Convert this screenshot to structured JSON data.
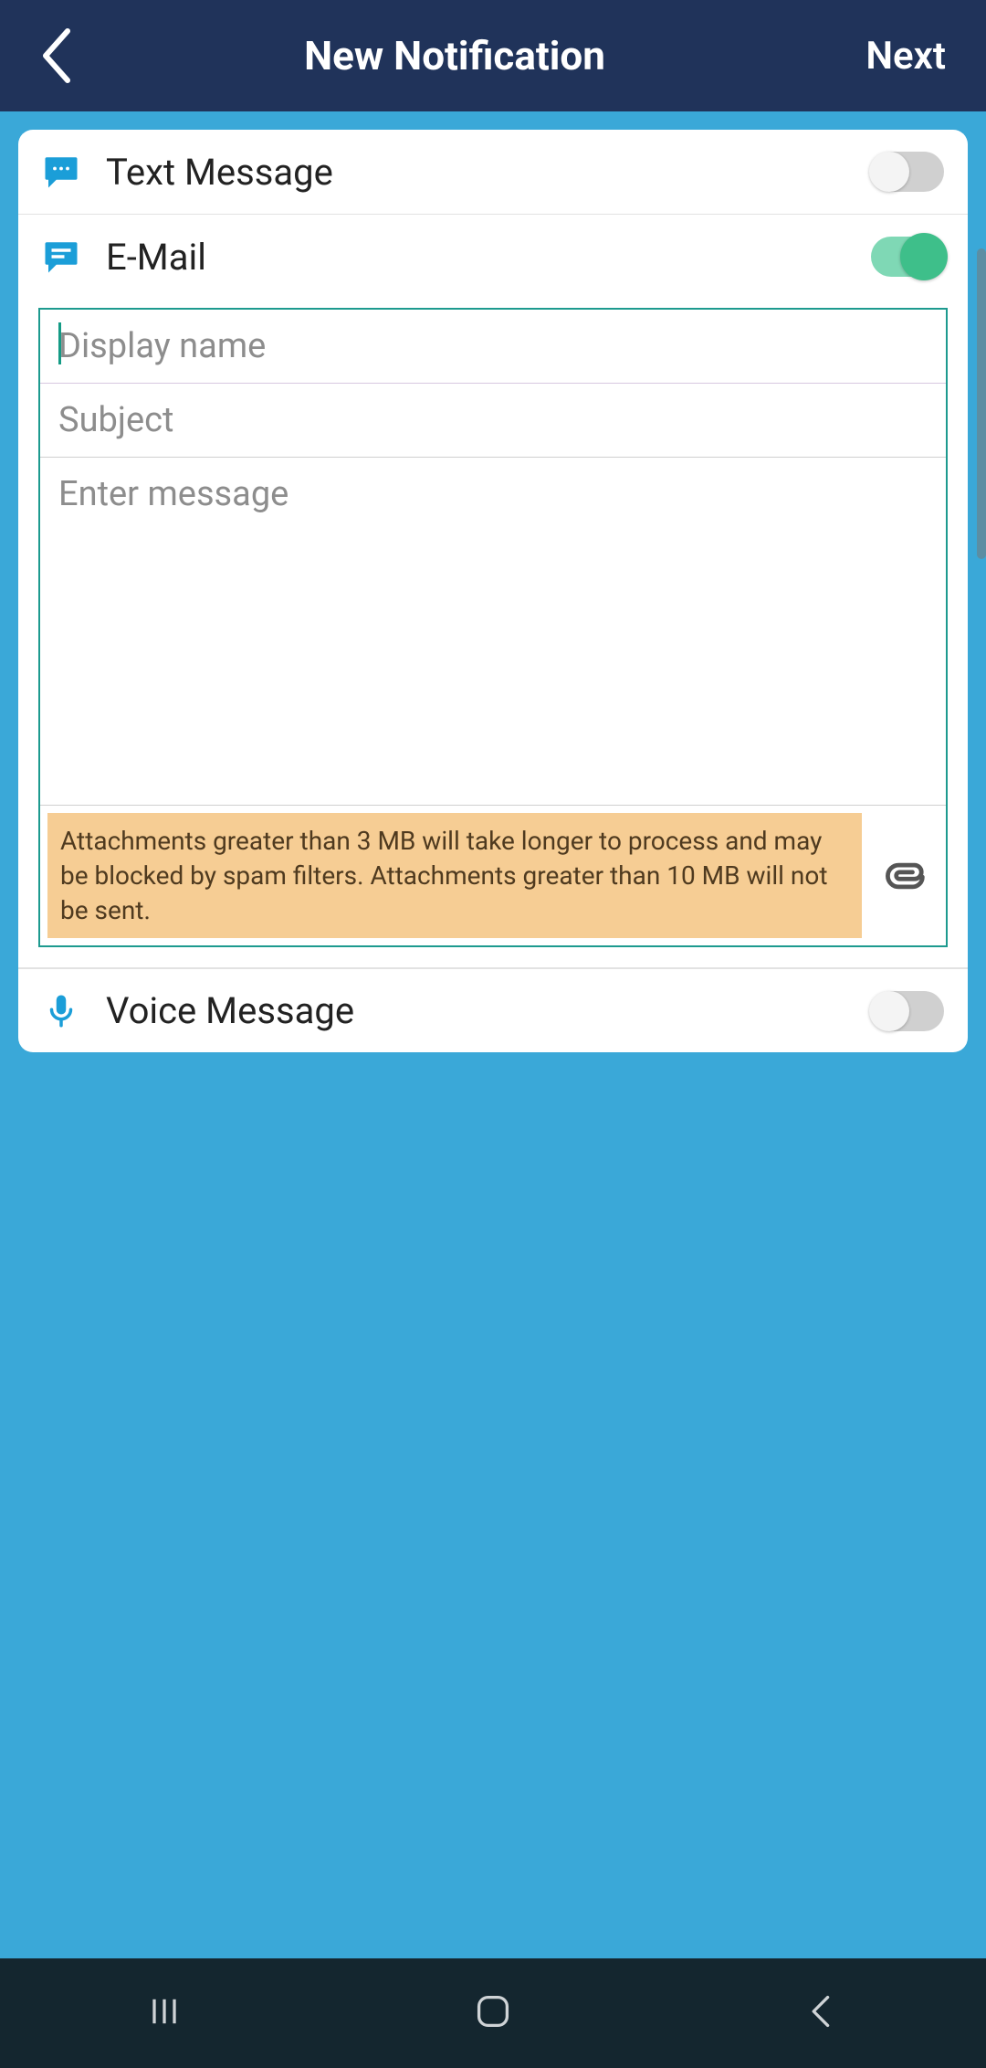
{
  "header": {
    "title": "New Notification",
    "next": "Next"
  },
  "sections": {
    "text_message": {
      "label": "Text Message",
      "enabled": false
    },
    "email": {
      "label": "E-Mail",
      "enabled": true,
      "display_name_placeholder": "Display name",
      "subject_placeholder": "Subject",
      "message_placeholder": "Enter message",
      "attachment_note": "Attachments greater than 3 MB will take longer to process and may be blocked by spam filters. Attachments greater than 10 MB will not be sent."
    },
    "voice_message": {
      "label": "Voice Message",
      "enabled": false
    }
  }
}
